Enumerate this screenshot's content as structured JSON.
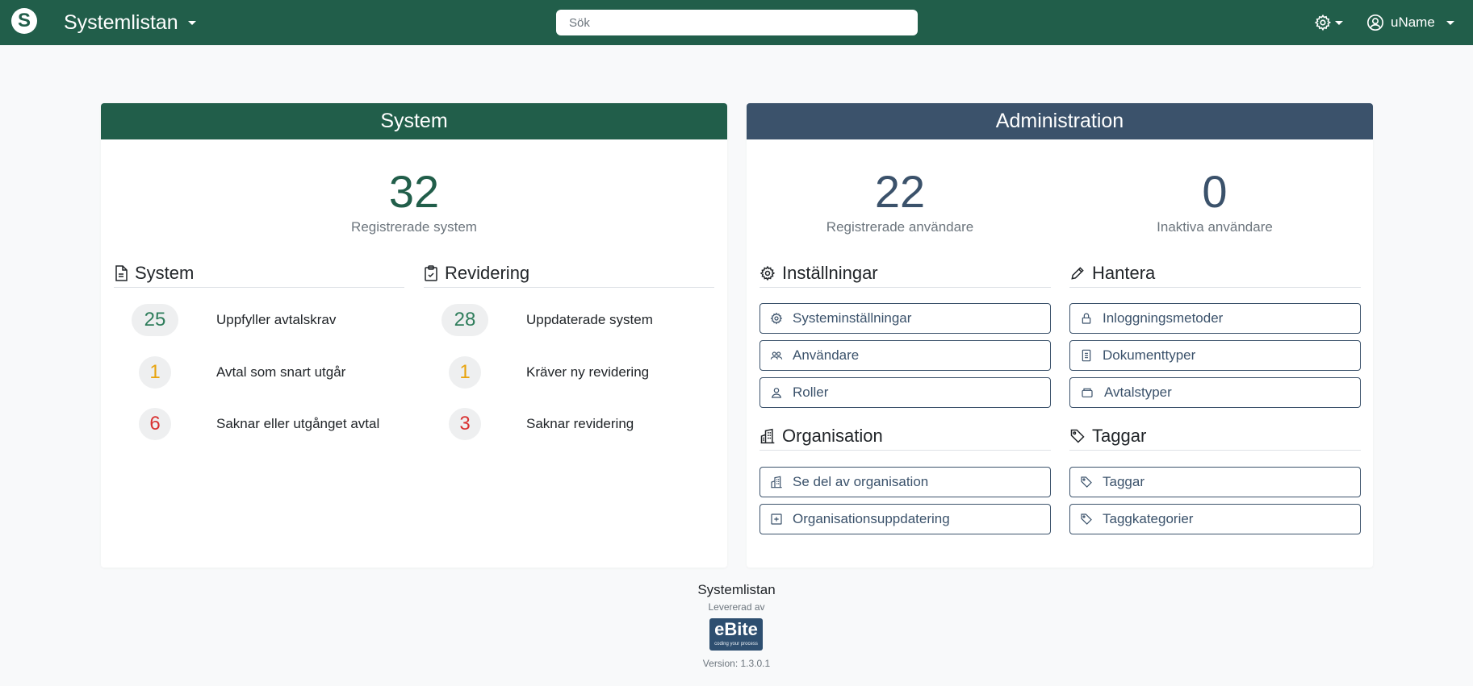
{
  "colors": {
    "brand_green": "#215e4a",
    "admin_blue": "#3b526b",
    "stat_green": "#2e7d5b",
    "stat_yellow": "#e8a30c",
    "stat_red": "#d93232"
  },
  "navbar": {
    "logo_letter": "S",
    "brand": "Systemlistan",
    "search_placeholder": "Sök",
    "settings_icon": "gear-icon",
    "user_name": "uName"
  },
  "system_card": {
    "header": "System",
    "total": "32",
    "total_label": "Registrerade system",
    "system_section": {
      "title": "System",
      "rows": [
        {
          "value": "25",
          "label": "Uppfyller avtalskrav"
        },
        {
          "value": "1",
          "label": "Avtal som snart utgår"
        },
        {
          "value": "6",
          "label": "Saknar eller utgånget avtal"
        }
      ]
    },
    "revision_section": {
      "title": "Revidering",
      "rows": [
        {
          "value": "28",
          "label": "Uppdaterade system"
        },
        {
          "value": "1",
          "label": "Kräver ny revidering"
        },
        {
          "value": "3",
          "label": "Saknar revidering"
        }
      ]
    }
  },
  "admin_card": {
    "header": "Administration",
    "users": "22",
    "users_label": "Registrerade användare",
    "inactive": "0",
    "inactive_label": "Inaktiva användare",
    "settings": {
      "title": "Inställningar",
      "buttons": [
        "Systeminställningar",
        "Användare",
        "Roller"
      ]
    },
    "manage": {
      "title": "Hantera",
      "buttons": [
        "Inloggningsmetoder",
        "Dokumenttyper",
        "Avtalstyper"
      ]
    },
    "organisation": {
      "title": "Organisation",
      "buttons": [
        "Se del av organisation",
        "Organisationsuppdatering"
      ]
    },
    "tags": {
      "title": "Taggar",
      "buttons": [
        "Taggar",
        "Taggkategorier"
      ]
    }
  },
  "footer": {
    "title": "Systemlistan",
    "delivered_by": "Levererad av",
    "logo_text": "eBite",
    "logo_tagline": "coding your process",
    "version": "Version: 1.3.0.1"
  }
}
